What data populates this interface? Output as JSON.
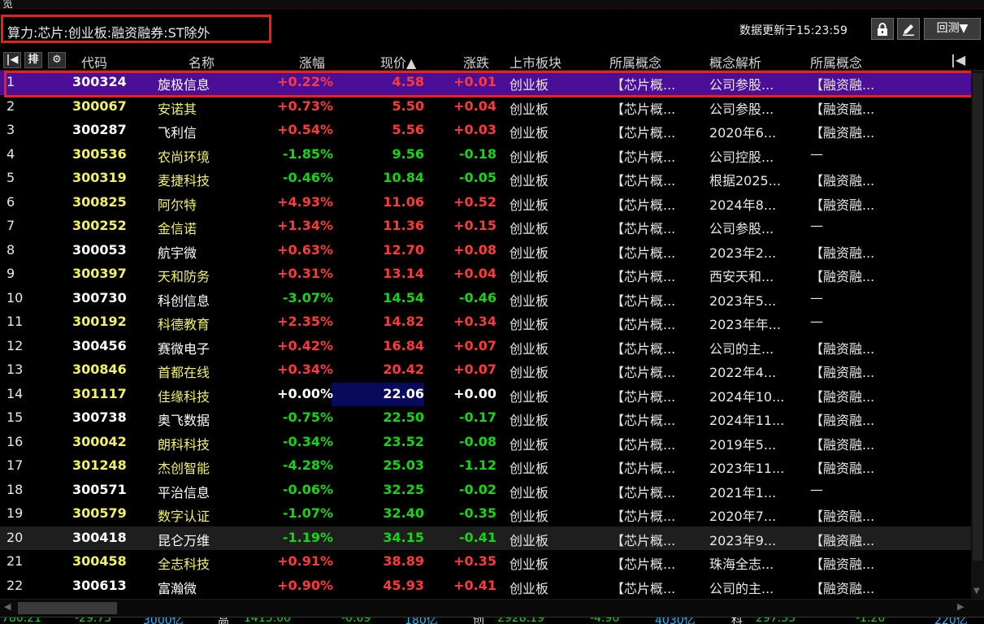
{
  "window": {
    "title": "览"
  },
  "condition": {
    "text": "算力:芯片:创业板:融资融券:ST除外"
  },
  "toolbar": {
    "update_time": "数据更新于15:23:59",
    "lock_icon": "lock-icon",
    "edit_icon": "edit-icon",
    "backtest_label": "回测",
    "backtest_arrow": "▼"
  },
  "header": {
    "icons": [
      {
        "name": "jump-first-icon",
        "glyph": "|◀"
      },
      {
        "name": "sort-icon",
        "glyph": "排"
      },
      {
        "name": "gear-icon",
        "glyph": "⚙"
      }
    ],
    "columns": {
      "code": "代码",
      "name": "名称",
      "pct": "涨幅",
      "price": "现价▲",
      "change": "涨跌",
      "board": "上市板块",
      "concept1": "所属概念",
      "analysis": "概念解析",
      "concept2": "所属概念"
    },
    "right_icon": "|◀"
  },
  "colors": {
    "up": "#ff3b3b",
    "down": "#15d615",
    "neutral": "#ffffff",
    "code_white": "#ffffff",
    "code_yellow": "#f2f264",
    "selected_bg": "#4a0f96"
  },
  "rows": [
    {
      "idx": "1",
      "code": "300324",
      "name": "旋极信息",
      "pct": "+0.22%",
      "price": "4.58",
      "chg": "+0.01",
      "board": "创业板",
      "con1": "【芯片概...",
      "ana": "公司参股...",
      "con2": "【融资融..."
    },
    {
      "idx": "2",
      "code": "300067",
      "name": "安诺其",
      "pct": "+0.73%",
      "price": "5.50",
      "chg": "+0.04",
      "board": "创业板",
      "con1": "【芯片概...",
      "ana": "公司参股...",
      "con2": "【融资融..."
    },
    {
      "idx": "3",
      "code": "300287",
      "name": "飞利信",
      "pct": "+0.54%",
      "price": "5.56",
      "chg": "+0.03",
      "board": "创业板",
      "con1": "【芯片概...",
      "ana": "2020年6...",
      "con2": "【融资融..."
    },
    {
      "idx": "4",
      "code": "300536",
      "name": "农尚环境",
      "pct": "-1.85%",
      "price": "9.56",
      "chg": "-0.18",
      "board": "创业板",
      "con1": "【芯片概...",
      "ana": "公司控股...",
      "con2": "—"
    },
    {
      "idx": "5",
      "code": "300319",
      "name": "麦捷科技",
      "pct": "-0.46%",
      "price": "10.84",
      "chg": "-0.05",
      "board": "创业板",
      "con1": "【芯片概...",
      "ana": "根据2025...",
      "con2": "【融资融..."
    },
    {
      "idx": "6",
      "code": "300825",
      "name": "阿尔特",
      "pct": "+4.93%",
      "price": "11.06",
      "chg": "+0.52",
      "board": "创业板",
      "con1": "【芯片概...",
      "ana": "2024年8...",
      "con2": "【融资融..."
    },
    {
      "idx": "7",
      "code": "300252",
      "name": "金信诺",
      "pct": "+1.34%",
      "price": "11.36",
      "chg": "+0.15",
      "board": "创业板",
      "con1": "【芯片概...",
      "ana": "公司参股...",
      "con2": "—"
    },
    {
      "idx": "8",
      "code": "300053",
      "name": "航宇微",
      "pct": "+0.63%",
      "price": "12.70",
      "chg": "+0.08",
      "board": "创业板",
      "con1": "【芯片概...",
      "ana": "2023年2...",
      "con2": "【融资融..."
    },
    {
      "idx": "9",
      "code": "300397",
      "name": "天和防务",
      "pct": "+0.31%",
      "price": "13.14",
      "chg": "+0.04",
      "board": "创业板",
      "con1": "【芯片概...",
      "ana": "西安天和...",
      "con2": "【融资融..."
    },
    {
      "idx": "10",
      "code": "300730",
      "name": "科创信息",
      "pct": "-3.07%",
      "price": "14.54",
      "chg": "-0.46",
      "board": "创业板",
      "con1": "【芯片概...",
      "ana": "2023年5...",
      "con2": "—"
    },
    {
      "idx": "11",
      "code": "300192",
      "name": "科德教育",
      "pct": "+2.35%",
      "price": "14.82",
      "chg": "+0.34",
      "board": "创业板",
      "con1": "【芯片概...",
      "ana": "2023年年...",
      "con2": "—"
    },
    {
      "idx": "12",
      "code": "300456",
      "name": "赛微电子",
      "pct": "+0.42%",
      "price": "16.84",
      "chg": "+0.07",
      "board": "创业板",
      "con1": "【芯片概...",
      "ana": "公司的主...",
      "con2": "【融资融..."
    },
    {
      "idx": "13",
      "code": "300846",
      "name": "首都在线",
      "pct": "+0.34%",
      "price": "20.42",
      "chg": "+0.07",
      "board": "创业板",
      "con1": "【芯片概...",
      "ana": "2022年4...",
      "con2": "【融资融..."
    },
    {
      "idx": "14",
      "code": "301117",
      "name": "佳缘科技",
      "pct": "+0.00%",
      "price": "22.06",
      "chg": "+0.00",
      "board": "创业板",
      "con1": "【芯片概...",
      "ana": "2024年10...",
      "con2": "【融资融..."
    },
    {
      "idx": "15",
      "code": "300738",
      "name": "奥飞数据",
      "pct": "-0.75%",
      "price": "22.50",
      "chg": "-0.17",
      "board": "创业板",
      "con1": "【芯片概...",
      "ana": "2024年11...",
      "con2": "【融资融..."
    },
    {
      "idx": "16",
      "code": "300042",
      "name": "朗科科技",
      "pct": "-0.34%",
      "price": "23.52",
      "chg": "-0.08",
      "board": "创业板",
      "con1": "【芯片概...",
      "ana": "2019年5...",
      "con2": "【融资融..."
    },
    {
      "idx": "17",
      "code": "301248",
      "name": "杰创智能",
      "pct": "-4.28%",
      "price": "25.03",
      "chg": "-1.12",
      "board": "创业板",
      "con1": "【芯片概...",
      "ana": "2023年11...",
      "con2": "【融资融..."
    },
    {
      "idx": "18",
      "code": "300571",
      "name": "平治信息",
      "pct": "-0.06%",
      "price": "32.25",
      "chg": "-0.02",
      "board": "创业板",
      "con1": "【芯片概...",
      "ana": "2021年1...",
      "con2": "—"
    },
    {
      "idx": "19",
      "code": "300579",
      "name": "数字认证",
      "pct": "-1.07%",
      "price": "32.40",
      "chg": "-0.35",
      "board": "创业板",
      "con1": "【芯片概...",
      "ana": "2020年7...",
      "con2": "【融资融..."
    },
    {
      "idx": "20",
      "code": "300418",
      "name": "昆仑万维",
      "pct": "-1.19%",
      "price": "34.15",
      "chg": "-0.41",
      "board": "创业板",
      "con1": "【芯片概...",
      "ana": "2023年9...",
      "con2": "【融资融..."
    },
    {
      "idx": "21",
      "code": "300458",
      "name": "全志科技",
      "pct": "+0.91%",
      "price": "38.89",
      "chg": "+0.35",
      "board": "创业板",
      "con1": "【芯片概...",
      "ana": "珠海全志...",
      "con2": "【融资融..."
    },
    {
      "idx": "22",
      "code": "300613",
      "name": "富瀚微",
      "pct": "+0.90%",
      "price": "45.93",
      "chg": "+0.41",
      "board": "创业板",
      "con1": "【芯片概...",
      "ana": "公司的主...",
      "con2": "【融资融..."
    }
  ],
  "code_colors": [
    "white",
    "yellow",
    "white",
    "yellow",
    "yellow",
    "yellow",
    "yellow",
    "white",
    "yellow",
    "white",
    "yellow",
    "white",
    "yellow",
    "yellow",
    "white",
    "yellow",
    "yellow",
    "white",
    "yellow",
    "white",
    "yellow",
    "white"
  ],
  "name_colors": [
    "white",
    "yellow",
    "white",
    "yellow",
    "yellow",
    "yellow",
    "yellow",
    "white",
    "yellow",
    "white",
    "yellow",
    "white",
    "yellow",
    "yellow",
    "white",
    "yellow",
    "yellow",
    "white",
    "yellow",
    "white",
    "yellow",
    "white"
  ],
  "status": {
    "items": [
      "780.21",
      "-29.75",
      "3000亿",
      "高",
      "1415.00",
      "-0.69",
      "180亿",
      "创",
      "2928.19",
      "-4.90",
      "4030亿",
      "科",
      "297.33",
      "-1.20",
      "220亿"
    ]
  }
}
